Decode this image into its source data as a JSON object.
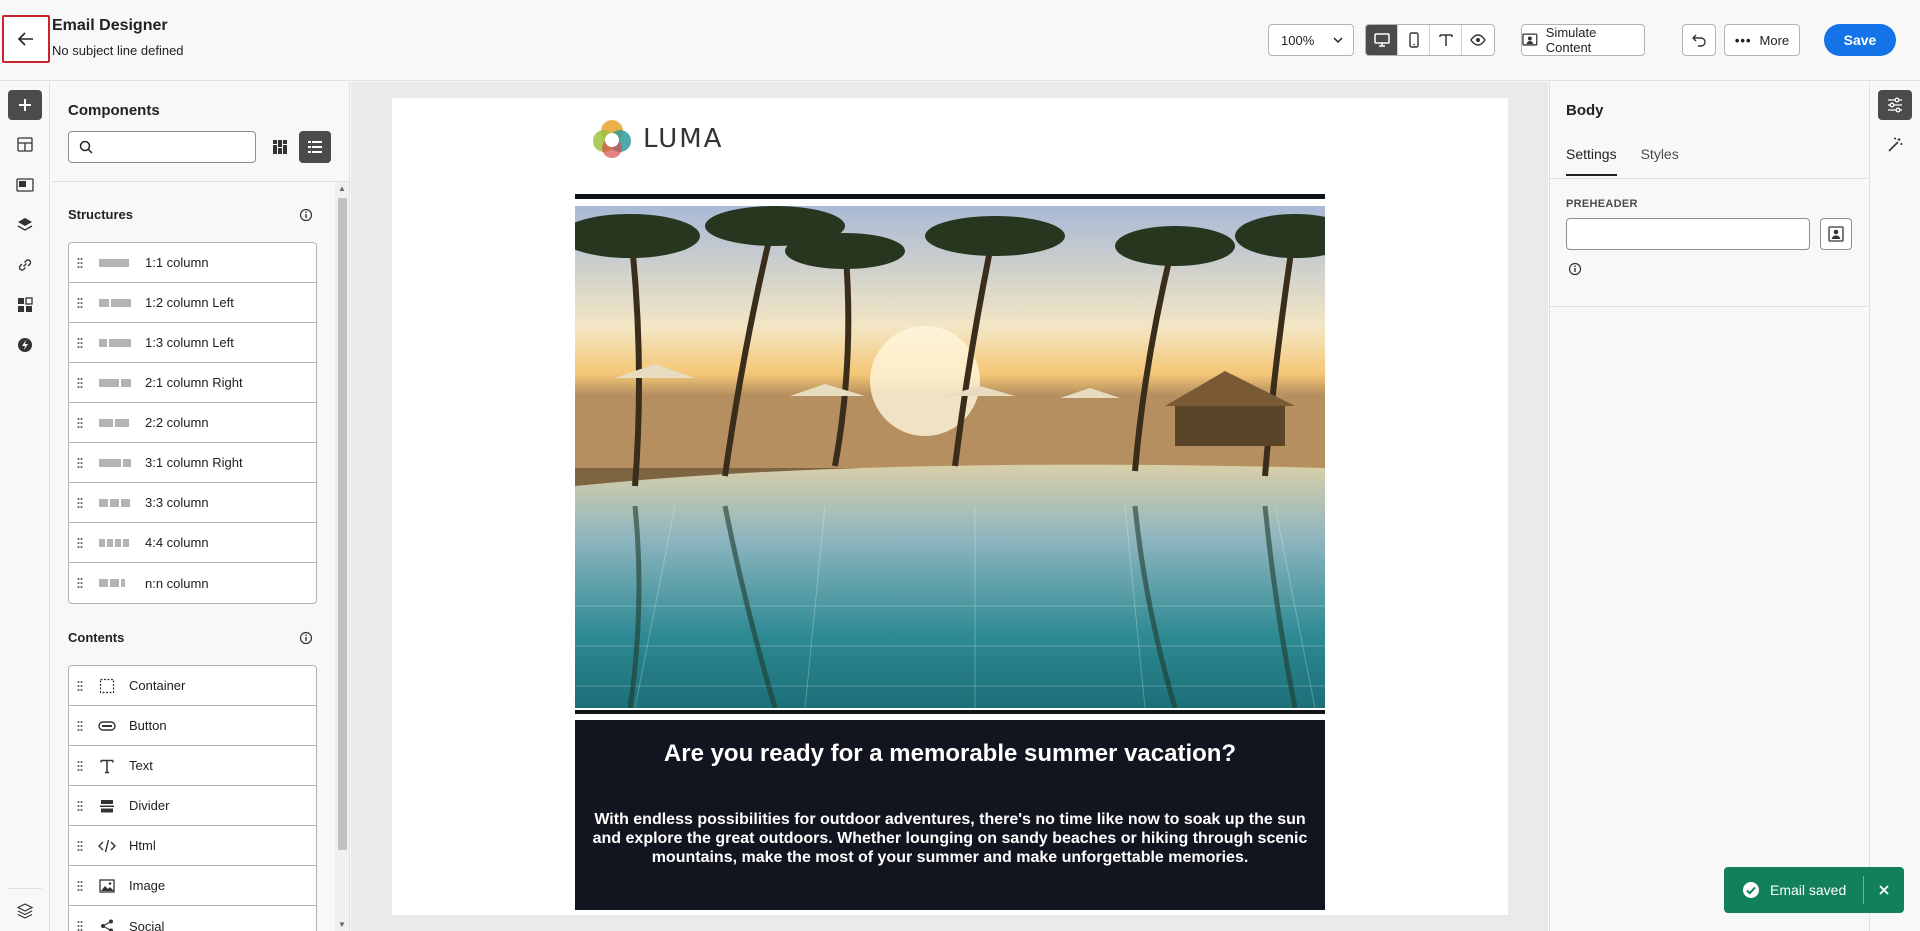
{
  "header": {
    "title": "Email Designer",
    "subtitle": "No subject line defined",
    "zoom": "100%",
    "simulate_label": "Simulate Content",
    "more_label": "More",
    "save_label": "Save"
  },
  "components": {
    "title": "Components",
    "search_placeholder": "",
    "structures_title": "Structures",
    "structures": [
      {
        "label": "1:1 column",
        "cols": [
          30
        ]
      },
      {
        "label": "1:2 column Left",
        "cols": [
          10,
          20
        ]
      },
      {
        "label": "1:3 column Left",
        "cols": [
          8,
          22
        ]
      },
      {
        "label": "2:1 column Right",
        "cols": [
          20,
          10
        ]
      },
      {
        "label": "2:2 column",
        "cols": [
          14,
          14
        ]
      },
      {
        "label": "3:1 column Right",
        "cols": [
          22,
          8
        ]
      },
      {
        "label": "3:3 column",
        "cols": [
          9,
          9,
          9
        ]
      },
      {
        "label": "4:4 column",
        "cols": [
          6,
          6,
          6,
          6
        ]
      },
      {
        "label": "n:n column",
        "cols": [
          9,
          9,
          4
        ]
      }
    ],
    "contents_title": "Contents",
    "contents": [
      {
        "label": "Container",
        "icon": "container-icon"
      },
      {
        "label": "Button",
        "icon": "button-icon"
      },
      {
        "label": "Text",
        "icon": "text-icon"
      },
      {
        "label": "Divider",
        "icon": "divider-icon"
      },
      {
        "label": "Html",
        "icon": "html-icon"
      },
      {
        "label": "Image",
        "icon": "image-icon"
      },
      {
        "label": "Social",
        "icon": "social-icon"
      }
    ]
  },
  "email": {
    "logo_text": "LUMA",
    "headline": "Are you ready for a memorable summer vacation?",
    "body": "With endless possibilities for outdoor adventures, there's no time like now to soak up the sun and explore the great outdoors. Whether lounging on sandy beaches or hiking through scenic mountains, make the most of your summer and make unforgettable memories."
  },
  "properties": {
    "title": "Body",
    "tabs": [
      "Settings",
      "Styles"
    ],
    "active_tab": "Settings",
    "preheader_label": "PREHEADER",
    "preheader_value": ""
  },
  "toast": {
    "message": "Email saved"
  },
  "colors": {
    "accent": "#1473e6",
    "success": "#12805c",
    "dark_block": "#12151f"
  }
}
